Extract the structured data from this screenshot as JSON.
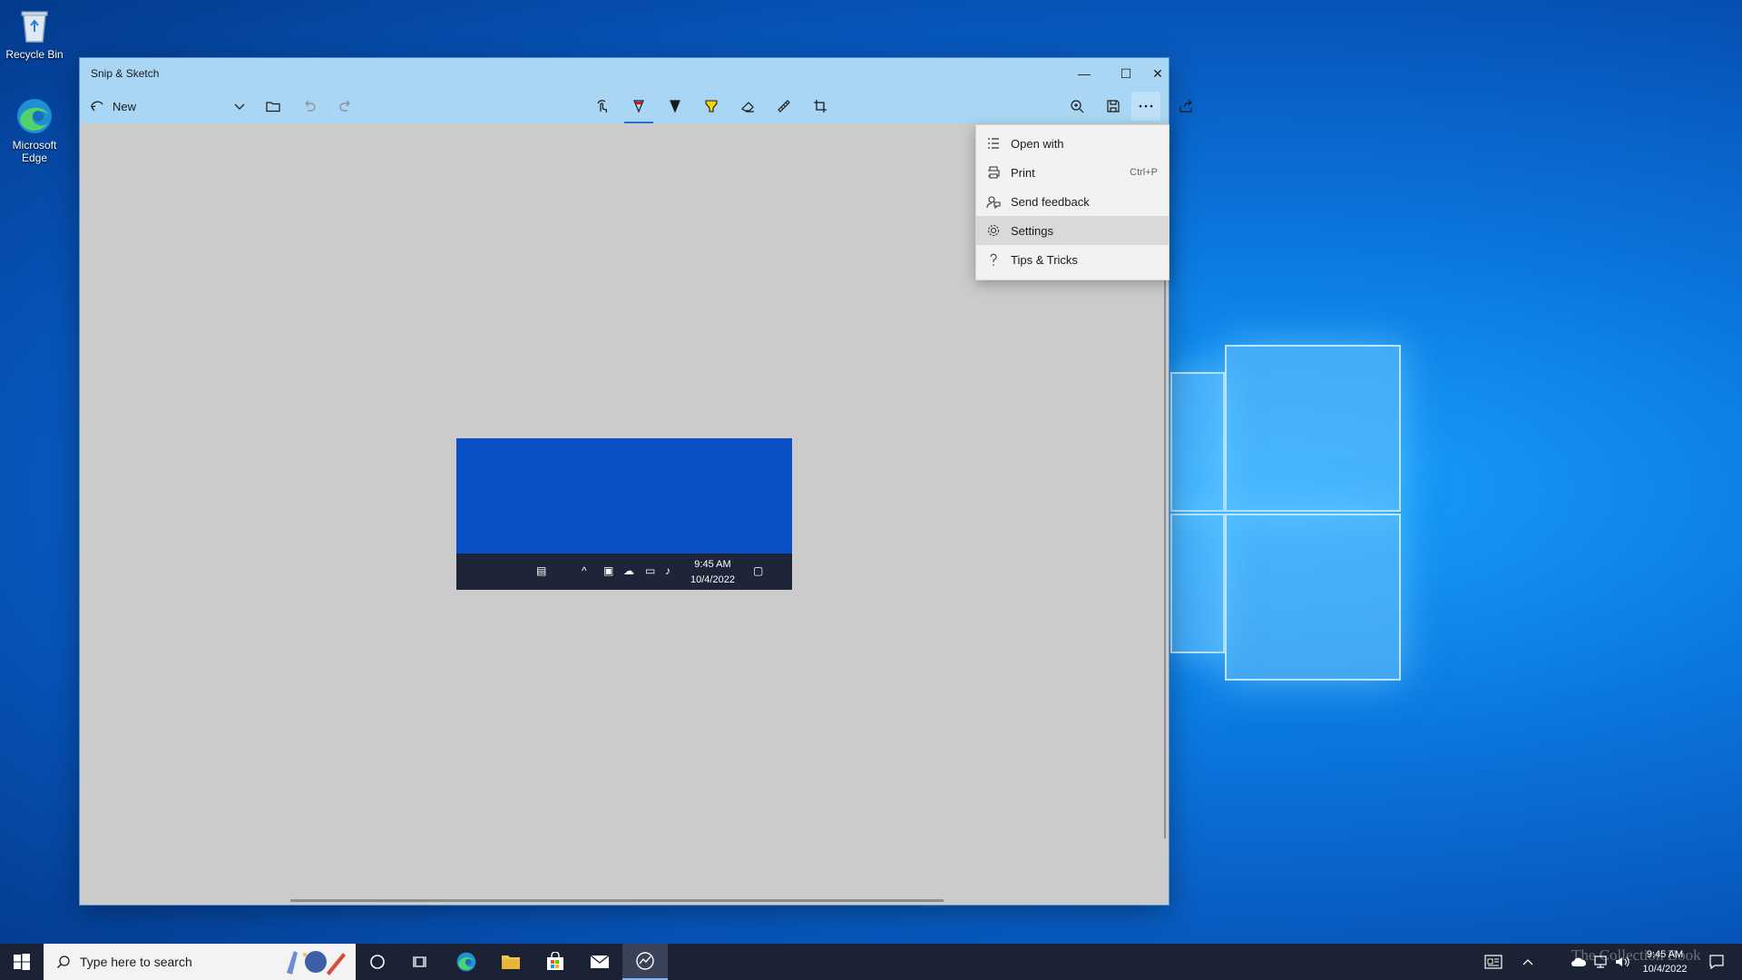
{
  "desktop": {
    "icons": [
      {
        "label": "Recycle Bin",
        "icon": "recycle-bin-icon"
      },
      {
        "label": "Microsoft Edge",
        "icon": "edge-icon"
      }
    ]
  },
  "window": {
    "title": "Snip & Sketch",
    "controls": {
      "minimize": "—",
      "maximize": "☐",
      "close": "✕"
    }
  },
  "toolbar": {
    "new_label": "New",
    "left_tools": [
      "new-snip-icon",
      "chevron-down-icon",
      "folder-icon",
      "undo-icon",
      "redo-icon"
    ],
    "center_tools": [
      "touch-writing-icon",
      "ballpoint-pen-icon",
      "pencil-icon",
      "highlighter-icon",
      "eraser-icon",
      "ruler-icon",
      "crop-icon"
    ],
    "right_tools": [
      "zoom-icon",
      "save-icon",
      "copy-icon",
      "share-icon",
      "more-icon"
    ],
    "active_tool": "ballpoint-pen-icon",
    "pen_color": "#e81123",
    "highlighter_color": "#f6d400"
  },
  "menu": {
    "items": [
      {
        "label": "Open with",
        "shortcut": "",
        "icon": "open-with-icon"
      },
      {
        "label": "Print",
        "shortcut": "Ctrl+P",
        "icon": "print-icon"
      },
      {
        "label": "Send feedback",
        "shortcut": "",
        "icon": "feedback-icon"
      },
      {
        "label": "Settings",
        "shortcut": "",
        "icon": "gear-icon",
        "hover": true
      },
      {
        "label": "Tips & Tricks",
        "shortcut": "",
        "icon": "question-icon"
      }
    ]
  },
  "snip": {
    "time": "9:45 AM",
    "date": "10/4/2022"
  },
  "taskbar": {
    "search_placeholder": "Type here to search",
    "time": "9:45 AM",
    "date": "10/4/2022",
    "accent": "#1b2233"
  },
  "watermark": "The Collection Book"
}
